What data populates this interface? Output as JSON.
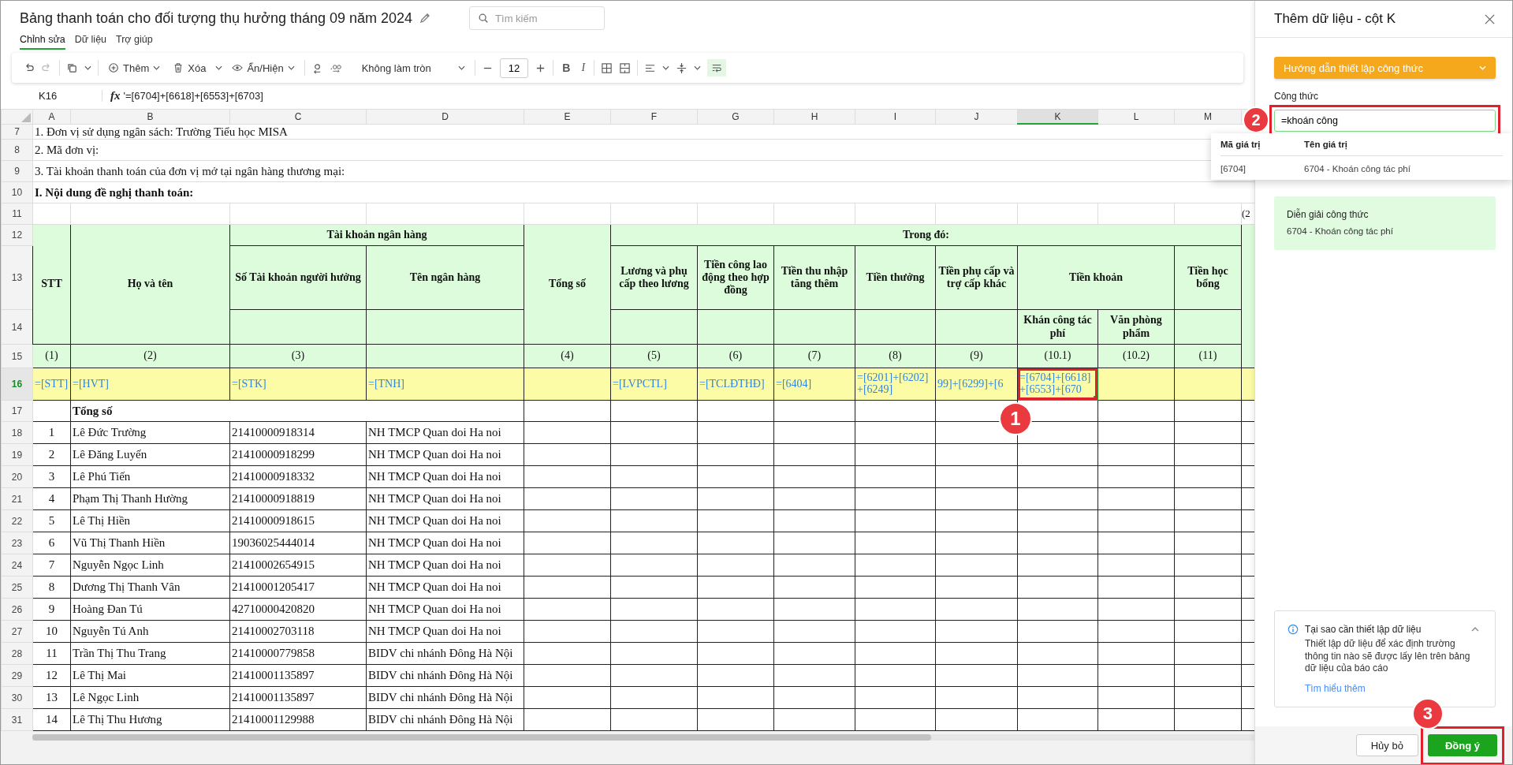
{
  "document": {
    "title": "Bảng thanh toán cho đối tượng thụ hưởng tháng 09 năm 2024",
    "search_placeholder": "Tìm kiếm"
  },
  "menu_tabs": [
    {
      "label": "Chỉnh sửa",
      "selected": true
    },
    {
      "label": "Dữ liệu",
      "selected": false
    },
    {
      "label": "Trợ giúp",
      "selected": false
    }
  ],
  "toolbar": {
    "add_label": "Thêm",
    "delete_label": "Xóa",
    "visibility_label": "Ẩn/Hiện",
    "rounding": "Không làm tròn",
    "font_size": "12",
    "bold": "B",
    "italic": "I",
    "wrap_on": true
  },
  "formula_bar": {
    "cell": "K16",
    "fx": "fx",
    "formula": "'=[6704]+[6618]+[6553]+[6703]"
  },
  "sheet": {
    "columns": [
      {
        "label": "A",
        "selected": false
      },
      {
        "label": "B",
        "selected": false
      },
      {
        "label": "C",
        "selected": false
      },
      {
        "label": "D",
        "selected": false
      },
      {
        "label": "E",
        "selected": false
      },
      {
        "label": "F",
        "selected": false
      },
      {
        "label": "G",
        "selected": false
      },
      {
        "label": "H",
        "selected": false
      },
      {
        "label": "I",
        "selected": false
      },
      {
        "label": "J",
        "selected": false
      },
      {
        "label": "K",
        "selected": true
      },
      {
        "label": "L",
        "selected": false
      },
      {
        "label": "M",
        "selected": false
      }
    ],
    "info_rows": [
      {
        "row": "7",
        "text": "1. Đơn vị sử dụng ngân sách: Trường Tiểu học MISA",
        "bold": false
      },
      {
        "row": "8",
        "text": "2. Mã đơn vị:",
        "bold": false
      },
      {
        "row": "9",
        "text": "3. Tài khoản thanh toán của đơn vị mở tại ngân hàng thương mại:",
        "bold": false
      },
      {
        "row": "10",
        "text": "I. Nội dung đề nghị thanh toán:",
        "bold": true
      }
    ],
    "blank_row": {
      "row": "11",
      "edge_text": "(2"
    },
    "header": {
      "rows": [
        "12",
        "13",
        "14"
      ],
      "stt": "STT",
      "name": "Họ và tên",
      "bank_group": "Tài khoản ngân hàng",
      "account": "Số Tài khoản người hưởng",
      "bank": "Tên ngân hàng",
      "total": "Tổng số",
      "breakdown": "Trong đó:",
      "items": [
        "Lương và phụ cấp theo lương",
        "Tiền công lao động theo hợp đồng",
        "Tiền thu nhập tăng thêm",
        "Tiền thưởng",
        "Tiền phụ cấp và trợ cấp khác"
      ],
      "lump": "Tiền khoản",
      "lump_items": [
        "Khán công tác phí",
        "Văn phòng phẩm"
      ],
      "scholarship": "Tiền học bổng"
    },
    "index_row": {
      "row": "15",
      "cells": [
        "(1)",
        "(2)",
        "(3)",
        null,
        "(4)",
        "(5)",
        "(6)",
        "(7)",
        "(8)",
        "(9)",
        "(10.1)",
        "(10.2)",
        "(11)"
      ]
    },
    "formula_row": {
      "row": "16",
      "selected": true,
      "cells": [
        {
          "text": "=[STT]",
          "selected": false
        },
        {
          "text": "=[HVT]",
          "selected": false
        },
        {
          "text": "=[STK]",
          "selected": false
        },
        {
          "text": "=[TNH]",
          "selected": false
        },
        {
          "selected": false
        },
        {
          "text": "=[LVPCTL]",
          "selected": false
        },
        {
          "text": "=[TCLĐTHĐ]",
          "selected": false
        },
        {
          "text": "=[6404]",
          "selected": false
        },
        {
          "text": "=[6201]+[6202]+[6249]",
          "selected": false
        },
        {
          "text": "99]+[6299]+[6",
          "selected": false
        },
        {
          "text": "=[6704]+[6618]+[6553]+[670",
          "selected": true
        },
        {
          "selected": false
        },
        {
          "selected": false
        }
      ]
    },
    "total_row": {
      "row": "17",
      "label": "Tổng số"
    },
    "data_rows": [
      {
        "row": "18",
        "stt": "1",
        "name": "Lê Đức Trường",
        "account": "21410000918314",
        "bank": "NH TMCP Quan doi Ha noi"
      },
      {
        "row": "19",
        "stt": "2",
        "name": "Lê Đăng Luyến",
        "account": "21410000918299",
        "bank": "NH TMCP Quan doi Ha noi"
      },
      {
        "row": "20",
        "stt": "3",
        "name": "Lê Phú Tiến",
        "account": "21410000918332",
        "bank": "NH TMCP Quan doi Ha noi"
      },
      {
        "row": "21",
        "stt": "4",
        "name": "Phạm Thị Thanh  Hường",
        "account": "21410000918819",
        "bank": "NH TMCP Quan doi Ha noi"
      },
      {
        "row": "22",
        "stt": "5",
        "name": "Lê Thị Hiền",
        "account": "21410000918615",
        "bank": "NH TMCP Quan doi Ha noi"
      },
      {
        "row": "23",
        "stt": "6",
        "name": "Vũ Thị Thanh Hiền",
        "account": "19036025444014",
        "bank": "NH TMCP Quan doi Ha noi"
      },
      {
        "row": "24",
        "stt": "7",
        "name": "Nguyễn Ngọc Linh",
        "account": "21410002654915",
        "bank": "NH TMCP Quan doi Ha noi"
      },
      {
        "row": "25",
        "stt": "8",
        "name": "Dương Thị Thanh Vân",
        "account": "21410001205417",
        "bank": "NH TMCP Quan doi Ha noi"
      },
      {
        "row": "26",
        "stt": "9",
        "name": "Hoàng Đan Tú",
        "account": "42710000420820",
        "bank": "NH TMCP Quan doi Ha noi"
      },
      {
        "row": "27",
        "stt": "10",
        "name": "Nguyễn Tú Anh",
        "account": "21410002703118",
        "bank": "NH TMCP Quan doi Ha noi"
      },
      {
        "row": "28",
        "stt": "11",
        "name": "Trần Thị Thu Trang",
        "account": "21410000779858",
        "bank": "BIDV chi nhánh Đông Hà Nội"
      },
      {
        "row": "29",
        "stt": "12",
        "name": "Lê Thị Mai",
        "account": "21410001135897",
        "bank": "BIDV chi nhánh Đông Hà Nội"
      },
      {
        "row": "30",
        "stt": "13",
        "name": "Lê Ngọc Linh",
        "account": "21410001135897",
        "bank": "BIDV chi nhánh Đông Hà Nội"
      },
      {
        "row": "31",
        "stt": "14",
        "name": "Lê Thị Thu Hương",
        "account": "21410001129988",
        "bank": "BIDV chi nhánh Đông Hà Nội"
      }
    ]
  },
  "panel": {
    "title": "Thêm dữ liệu - cột K",
    "guide_button": "Hướng dẫn thiết lập công thức",
    "formula_label": "Công thức",
    "formula_value": "=khoán công",
    "suggestions": {
      "columns": [
        "Mã giá trị",
        "Tên giá trị"
      ],
      "rows": [
        {
          "code": "[6704]",
          "name": "6704 - Khoán công tác phí"
        }
      ]
    },
    "explanation": {
      "title": "Diễn giải công thức",
      "text": "6704 - Khoán công tác phí"
    },
    "info": {
      "title": "Tại sao cần thiết lập dữ liệu",
      "expanded": true,
      "text": "Thiết lập dữ liệu để xác định trường thông tin nào sẽ được lấy lên trên bảng dữ liệu của báo cáo",
      "link": "Tìm hiểu thêm"
    },
    "cancel": "Hủy bỏ",
    "confirm": "Đồng ý"
  },
  "annotations": [
    {
      "kind": "cell",
      "number": "1"
    },
    {
      "kind": "input",
      "number": "2"
    },
    {
      "kind": "button",
      "number": "3"
    }
  ]
}
